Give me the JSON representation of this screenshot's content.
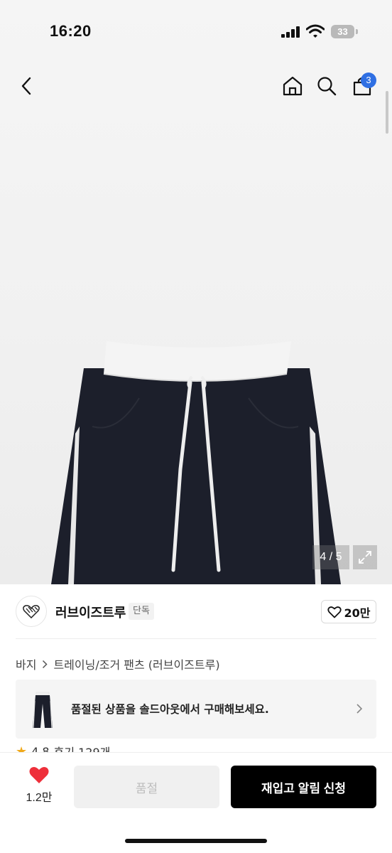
{
  "status_bar": {
    "time": "16:20",
    "battery": "33"
  },
  "header": {
    "cart_badge": "3"
  },
  "gallery": {
    "counter": "4 / 5",
    "current": 4,
    "total": 5
  },
  "brand": {
    "name": "러브이즈트루",
    "tag": "단독",
    "likes": "20만"
  },
  "breadcrumb": {
    "items": [
      "바지",
      "트레이닝/조거 팬츠 (러브이즈트루)"
    ]
  },
  "banner": {
    "text": "품절된 상품을 솔드아웃에서 구매해보세요."
  },
  "rating": {
    "score": "4.8",
    "reviews": "후기 129개"
  },
  "bottom": {
    "like_count": "1.2만",
    "soldout_label": "품절",
    "restock_label": "재입고 알림 신청"
  },
  "colors": {
    "accent_blue": "#2f6fe3",
    "heart_red": "#ee2f3a",
    "pants_navy": "#1c1f2b"
  }
}
